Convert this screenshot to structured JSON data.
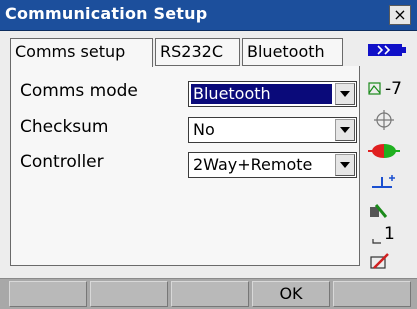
{
  "window": {
    "title": "Communication Setup",
    "close_label": "×"
  },
  "tabs": [
    {
      "label": "Comms setup",
      "active": true
    },
    {
      "label": "RS232C",
      "active": false
    },
    {
      "label": "Bluetooth",
      "active": false
    }
  ],
  "fields": [
    {
      "label": "Comms mode",
      "value": "Bluetooth",
      "selected": true
    },
    {
      "label": "Checksum",
      "value": "No",
      "selected": false
    },
    {
      "label": "Controller",
      "value": "2Way+Remote",
      "selected": false
    }
  ],
  "status": {
    "battery_icon": "battery-icon",
    "tilt_value": "-7",
    "compensator_icon": "crosshair-icon",
    "target_icon": "target-icon",
    "level_icon": "level-icon",
    "mode_icon": "measurement-mode-icon",
    "count_value": "1",
    "edit_icon": "edit-icon"
  },
  "softkeys": [
    "",
    "",
    "",
    "OK",
    ""
  ],
  "colors": {
    "title_bg": "#1c4f9c",
    "selection_bg": "#0a0a7a",
    "battery": "#1010c8",
    "target_red": "#e02020",
    "target_green": "#20b020",
    "level": "#1a4fd0"
  }
}
